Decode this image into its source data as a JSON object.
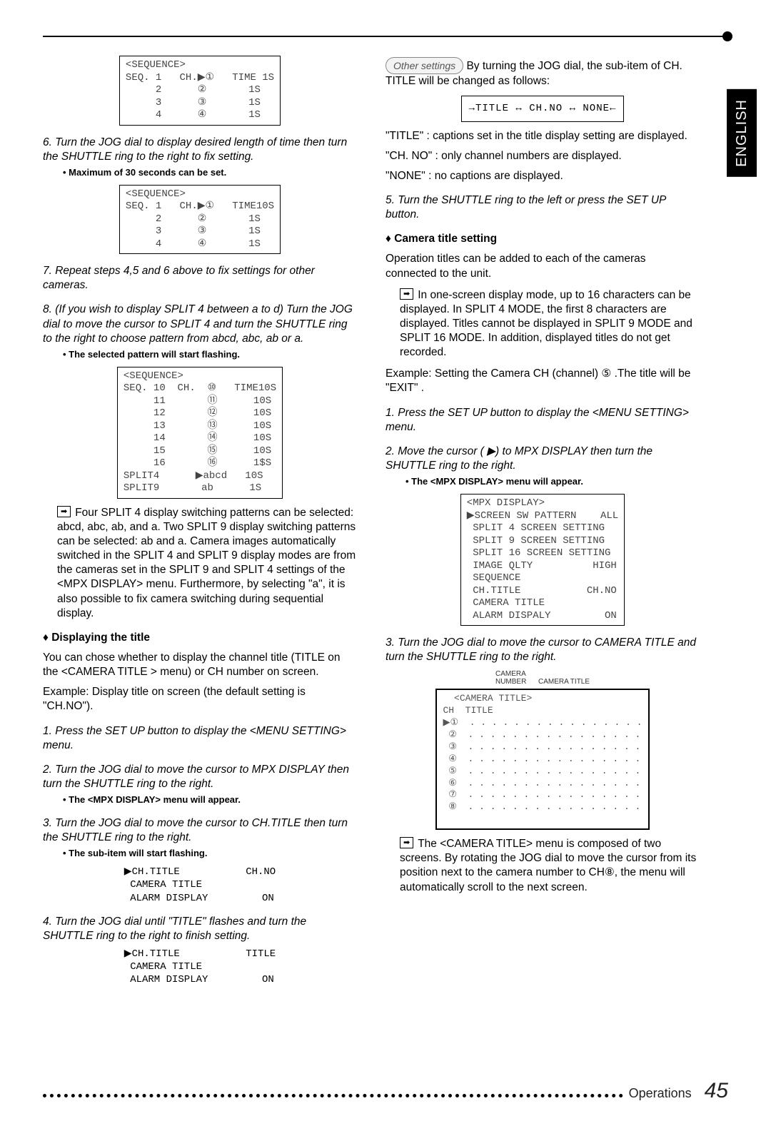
{
  "sideTab": "ENGLISH",
  "pageNumber": "45",
  "footerLabel": "Operations",
  "left": {
    "seqBox1": "<SEQUENCE>\nSEQ. 1   CH.▶①   TIME 1S\n     2      ②       1S\n     3      ③       1S\n     4      ④       1S",
    "step6": "6. Turn the JOG dial to display desired length of time then turn the SHUTTLE ring to the right to fix setting.",
    "bullet6": "• Maximum of 30 seconds can be set.",
    "seqBox2": "<SEQUENCE>\nSEQ. 1   CH.▶①   TIME10S\n     2      ②       1S\n     3      ③       1S\n     4      ④       1S",
    "step7": "7. Repeat steps 4,5 and 6 above to fix settings for other cameras.",
    "step8": "8. (If you wish to display SPLIT 4 between a to d) Turn the JOG dial to move the cursor to SPLIT 4 and turn the SHUTTLE ring to the right to choose pattern from abcd, abc, ab or a.",
    "bullet8": "• The selected pattern will start flashing.",
    "seqBox3": "<SEQUENCE>\nSEQ. 10  CH.  ⑩   TIME10S\n     11       ⑪      10S\n     12       ⑫      10S\n     13       ⑬      10S\n     14       ⑭      10S\n     15       ⑮      10S\n     16       ⑯      1$S\nSPLIT4      ▶abcd   10S\nSPLIT9       ab      1S",
    "note1": "Four SPLIT 4 display switching patterns can be selected: abcd, abc, ab, and a. Two SPLIT 9 display switching patterns can be selected: ab and a. Camera images automatically switched in the SPLIT 4 and SPLIT 9 display modes are from the cameras set in the SPLIT 9 and SPLIT 4 settings of the <MPX DISPLAY> menu. Furthermore, by selecting \"a\", it is also possible to fix camera switching during sequential display.",
    "hdrDisplaying": "Displaying the title",
    "dispBody1": "You can chose whether to display the channel title (TITLE on the <CAMERA TITLE > menu) or CH number on screen.",
    "dispBody2": "Example: Display title on screen (the default setting is \"CH.NO\").",
    "step1": "1. Press the SET UP button to display the <MENU SETTING> menu.",
    "step2": "2. Turn the JOG dial to move the cursor to MPX DISPLAY then turn the SHUTTLE ring to the right.",
    "bullet2": "• The <MPX DISPLAY> menu will appear.",
    "step3": "3. Turn the JOG dial to move the cursor to CH.TITLE then turn the SHUTTLE ring to the right.",
    "bullet3": "• The sub-item will start flashing.",
    "chSnippet1": "▶CH.TITLE           CH.NO\n CAMERA TITLE\n ALARM DISPLAY         ON",
    "step4": "4. Turn the JOG dial until \"TITLE\" flashes and turn the SHUTTLE ring to the right to finish setting.",
    "chSnippet2": "▶CH.TITLE           TITLE\n CAMERA TITLE\n ALARM DISPLAY         ON"
  },
  "right": {
    "otherSettings": "Other settings",
    "otherBody": " By turning the JOG dial, the sub-item of CH. TITLE will be changed as follows:",
    "flow": "→TITLE ↔ CH.NO ↔ NONE←",
    "titleLine": "\"TITLE\" : captions set in the title display setting are displayed.",
    "chnoLine": "\"CH. NO\" :  only channel numbers are displayed.",
    "noneLine": "\"NONE\" :  no captions are displayed.",
    "step5": "5. Turn the SHUTTLE ring to the left or press the SET UP button.",
    "hdrCamera": "Camera title setting",
    "camBody1": "Operation titles can be added to each of the cameras connected to the unit.",
    "camNote": "In one-screen display mode, up to 16 characters can be displayed. In SPLIT 4 MODE, the first 8 characters are displayed. Titles cannot be displayed in SPLIT 9 MODE and SPLIT 16 MODE. In addition, displayed titles do not get recorded.",
    "camExample": "Example: Setting the Camera CH (channel) ⑤ .The title will be \"EXIT\" .",
    "camStep1": "1. Press the SET UP button to display the <MENU SETTING> menu.",
    "camStep2": "2. Move the cursor ( ▶) to MPX DISPLAY then turn the SHUTTLE ring to the right.",
    "camBullet2": "• The <MPX DISPLAY> menu will appear.",
    "mpxBox": "<MPX DISPLAY>\n▶SCREEN SW PATTERN    ALL\n SPLIT 4 SCREEN SETTING\n SPLIT 9 SCREEN SETTING\n SPLIT 16 SCREEN SETTING\n IMAGE QLTY          HIGH\n SEQUENCE\n CH.TITLE           CH.NO\n CAMERA TITLE\n ALARM DISPALY         ON",
    "camStep3": "3. Turn the JOG dial to move the cursor to CAMERA TITLE and turn the SHUTTLE ring to the right.",
    "camLabels": "CAMERA\nNUMBER      CAMERA TITLE",
    "camTitleBox": "  <CAMERA TITLE>\nCH  TITLE\n▶①  . . . . . . . . . . . . . . . .\n ②  . . . . . . . . . . . . . . . .\n ③  . . . . . . . . . . . . . . . .\n ④  . . . . . . . . . . . . . . . .\n ⑤  . . . . . . . . . . . . . . . .\n ⑥  . . . . . . . . . . . . . . . .\n ⑦  . . . . . . . . . . . . . . . .\n ⑧  . . . . . . . . . . . . . . . .\n ",
    "camNote2": "The <CAMERA TITLE> menu is composed of two screens. By rotating the JOG dial to move the cursor from its position next to the camera number to CH⑧, the menu will automatically scroll to the next screen."
  }
}
